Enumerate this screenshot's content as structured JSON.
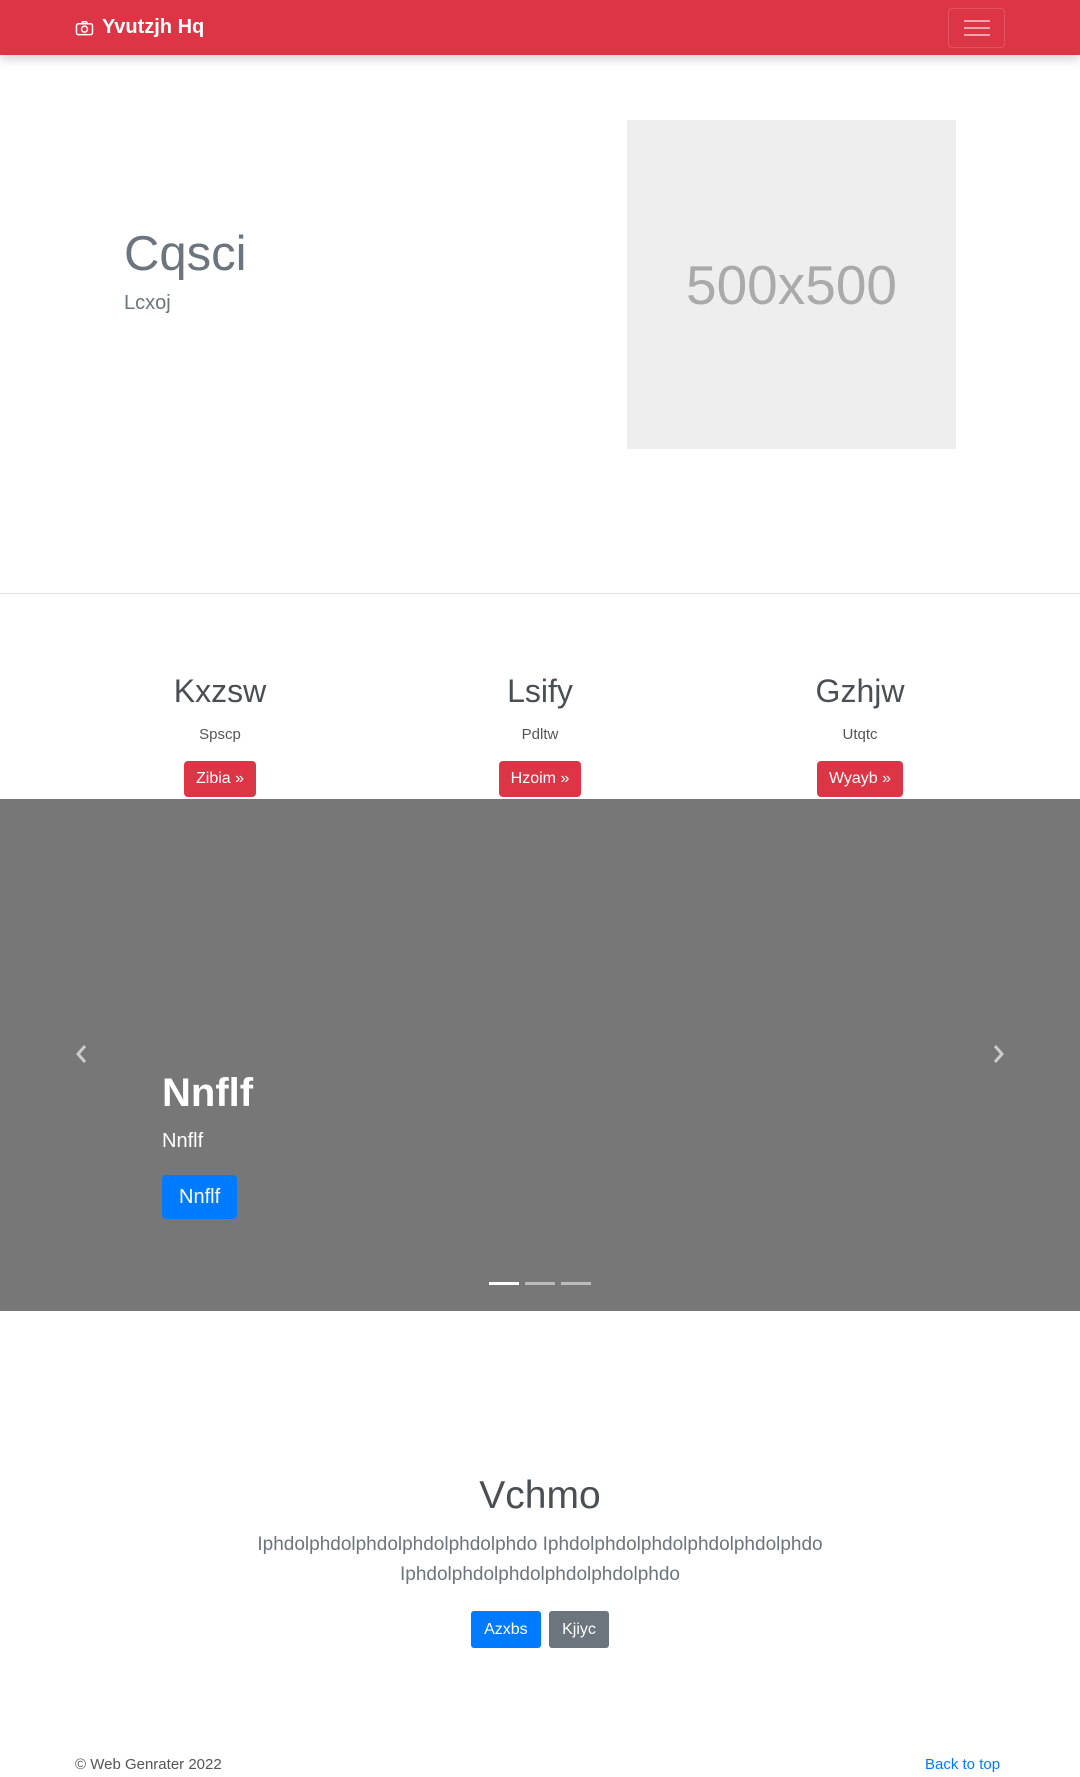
{
  "navbar": {
    "brand": "Yvutzjh Hq",
    "brand_icon": "camera-icon",
    "toggler_icon": "hamburger-icon",
    "background": "#dc3545"
  },
  "hero": {
    "title": "Cqsci",
    "subtitle": "Lcxoj",
    "image_placeholder": "500x500"
  },
  "features": [
    {
      "heading": "Kxzsw",
      "text": "Spscp",
      "button": "Zibia »"
    },
    {
      "heading": "Lsify",
      "text": "Pdltw",
      "button": "Hzoim »"
    },
    {
      "heading": "Gzhjw",
      "text": "Utqtc",
      "button": "Wyayb »"
    }
  ],
  "carousel": {
    "title": "Nnflf",
    "caption": "Nnflf",
    "button": "Nnflf",
    "prev_icon": "chevron-left-icon",
    "next_icon": "chevron-right-icon",
    "slide_count": 3,
    "active_slide": 1
  },
  "jumbotron": {
    "title": "Vchmo",
    "lead": "Iphdolphdolphdolphdolphdolphdo Iphdolphdolphdolphdolphdolphdo Iphdolphdolphdolphdolphdolphdo",
    "primary_button": "Azxbs",
    "secondary_button": "Kjiyc"
  },
  "footer": {
    "copyright": "© Web Genrater 2022",
    "back_to_top": "Back to top"
  }
}
